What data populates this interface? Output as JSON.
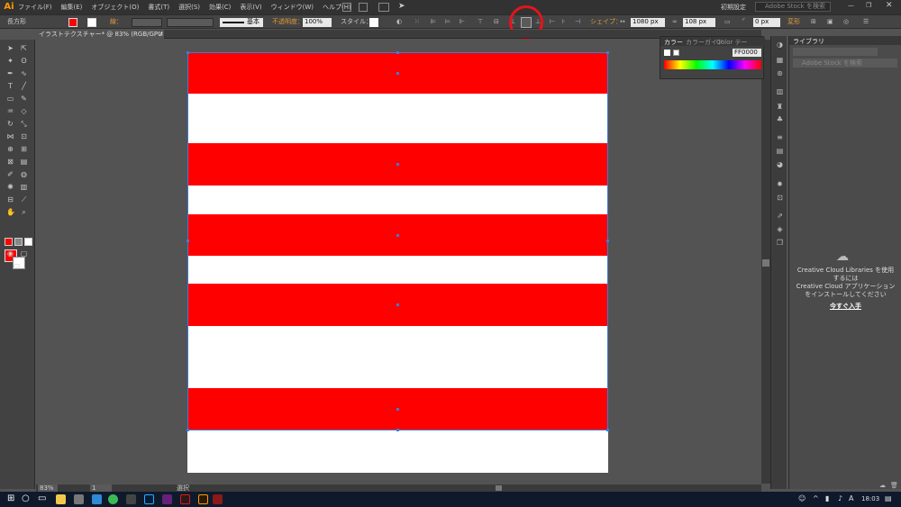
{
  "app": {
    "logo": "Ai"
  },
  "menubar": {
    "items": [
      "ファイル(F)",
      "編集(E)",
      "オブジェクト(O)",
      "書式(T)",
      "選択(S)",
      "効果(C)",
      "表示(V)",
      "ウィンドウ(W)",
      "ヘルプ(H)"
    ],
    "workspace": "初期設定",
    "stock_search_placeholder": "Adobe Stock を検索"
  },
  "controlbar": {
    "object_type": "長方形",
    "stroke_label": "線：",
    "stroke_style": "基本",
    "opacity_label": "不透明度：",
    "opacity_value": "100%",
    "style_label": "スタイル：",
    "shape_label": "シェイプ：",
    "width_value": "1080 px",
    "height_value": "108 px",
    "corner_value": "0 px",
    "transform_label": "変形"
  },
  "document": {
    "tab_title": "イラストテクスチャー* @ 83% (RGB/GPU プレビュー)"
  },
  "status": {
    "zoom": "83%",
    "page": "1",
    "tool_status": "選択"
  },
  "color_panel": {
    "tabs": [
      "カラー",
      "カラーガイド",
      "Color テー"
    ],
    "hex_value": "FF0000"
  },
  "library_panel": {
    "title": "ライブラリ",
    "search_placeholder": "Adobe Stock を検索",
    "message_line1": "Creative Cloud Libraries を使用するには",
    "message_line2": "Creative Cloud アプリケーションをインストールしてください",
    "install_link": "今すぐ入手"
  },
  "taskbar": {
    "time": "18:03"
  },
  "colors": {
    "fill": "#ff0000",
    "stroke": "#ffffff",
    "highlight": "#e5141b"
  }
}
